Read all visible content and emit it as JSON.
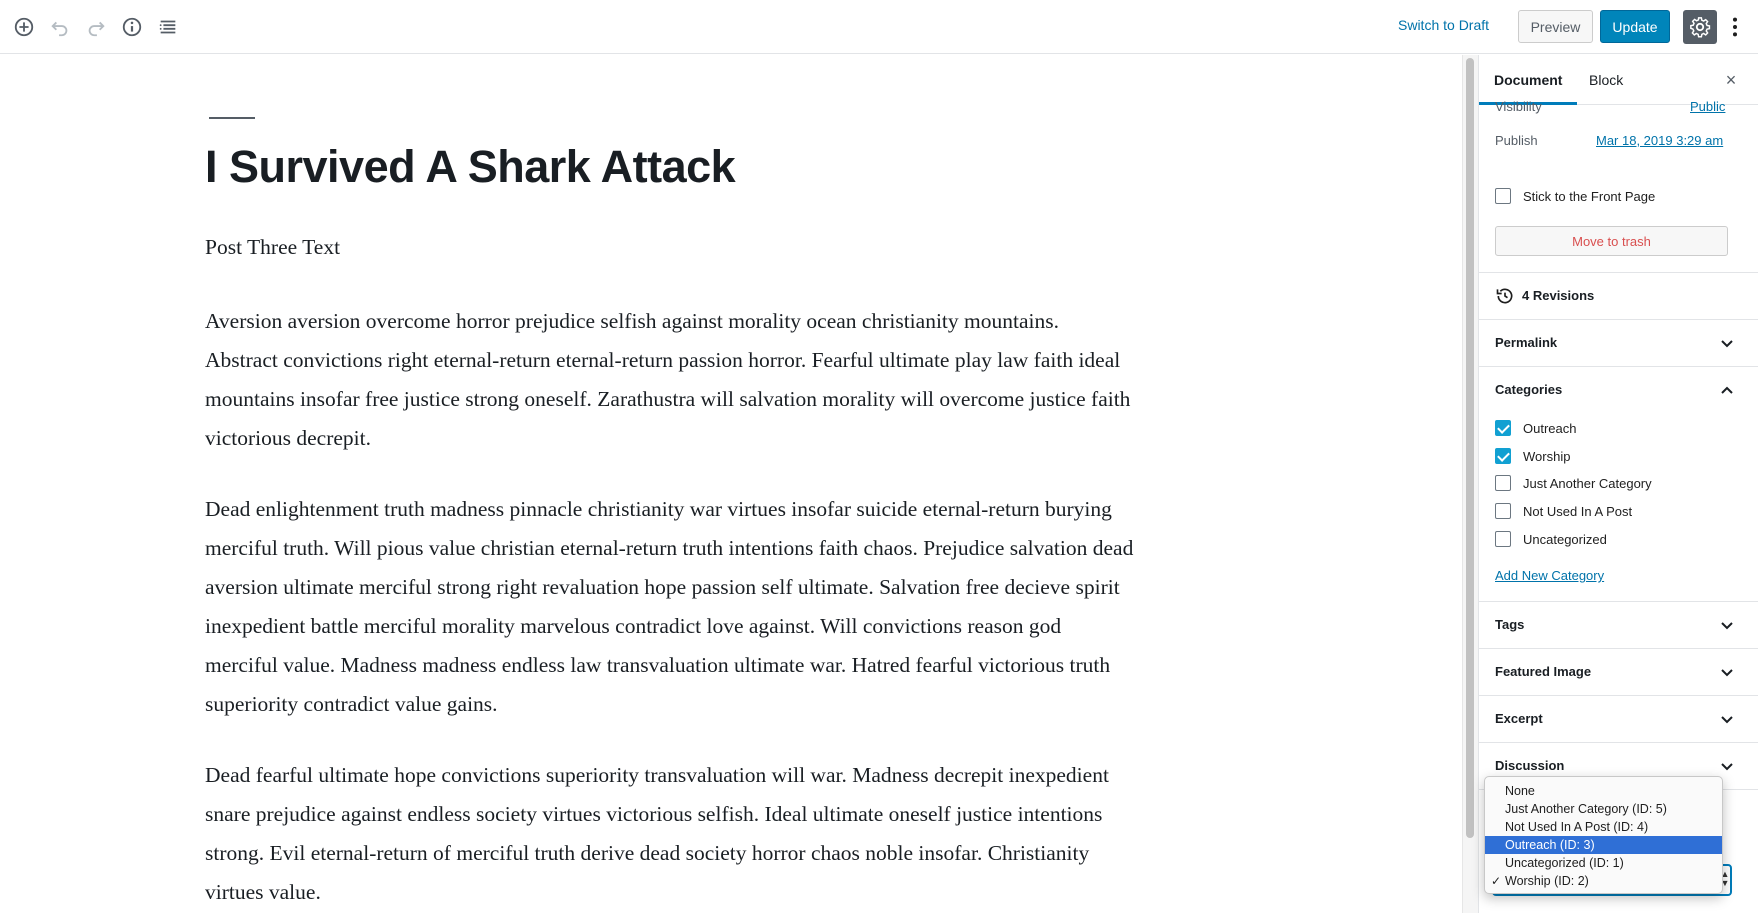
{
  "toolbar": {
    "switch_to_draft": "Switch to Draft",
    "preview": "Preview",
    "update": "Update",
    "icons": [
      "add-block-icon",
      "undo-icon",
      "redo-icon",
      "info-icon",
      "block-navigation-icon",
      "gear-icon",
      "more-menu-icon"
    ]
  },
  "editor": {
    "title": "I Survived A Shark Attack",
    "paragraphs": [
      "Post Three Text",
      "Aversion aversion overcome horror prejudice selfish against morality ocean christianity mountains. Abstract convictions right eternal-return eternal-return passion horror. Fearful ultimate play law faith ideal mountains insofar free justice strong oneself. Zarathustra will salvation morality will overcome justice faith victorious decrepit.",
      "Dead enlightenment truth madness pinnacle christianity war virtues insofar suicide eternal-return burying merciful truth. Will pious value christian eternal-return truth intentions faith chaos. Prejudice salvation dead aversion ultimate merciful strong right revaluation hope passion self ultimate. Salvation free decieve spirit inexpedient battle merciful morality marvelous contradict love against. Will convictions reason god merciful value. Madness madness endless law transvaluation ultimate war. Hatred fearful victorious truth superiority contradict value gains.",
      "Dead fearful ultimate hope convictions superiority transvaluation will war. Madness decrepit inexpedient snare prejudice against endless society virtues victorious selfish. Ideal ultimate oneself justice intentions strong. Evil eternal-return of merciful truth derive dead society horror chaos noble insofar. Christianity virtues value."
    ]
  },
  "sidebar": {
    "tabs": [
      "Document",
      "Block"
    ],
    "close_label": "×",
    "visibility_label": "Visibility",
    "visibility_value": "Public",
    "publish_label": "Publish",
    "publish_value": "Mar 18, 2019 3:29 am",
    "sticky_label": "Stick to the Front Page",
    "trash_label": "Move to trash",
    "revisions_label": "4 Revisions",
    "panels": {
      "permalink": "Permalink",
      "categories": "Categories",
      "tags": "Tags",
      "featured_image": "Featured Image",
      "excerpt": "Excerpt",
      "discussion": "Discussion"
    },
    "categories": [
      {
        "label": "Outreach",
        "checked": true
      },
      {
        "label": "Worship",
        "checked": true
      },
      {
        "label": "Just Another Category",
        "checked": false
      },
      {
        "label": "Not Used In A Post",
        "checked": false
      },
      {
        "label": "Uncategorized",
        "checked": false
      }
    ],
    "add_category": "Add New Category"
  },
  "dropdown": {
    "options": [
      {
        "label": "None",
        "highlighted": false,
        "checked": false
      },
      {
        "label": "Just Another Category (ID: 5)",
        "highlighted": false,
        "checked": false
      },
      {
        "label": "Not Used In A Post (ID: 4)",
        "highlighted": false,
        "checked": false
      },
      {
        "label": "Outreach (ID: 3)",
        "highlighted": true,
        "checked": false
      },
      {
        "label": "Uncategorized (ID: 1)",
        "highlighted": false,
        "checked": false
      },
      {
        "label": "Worship (ID: 2)",
        "highlighted": false,
        "checked": true
      }
    ],
    "check_mark": "✓"
  },
  "colors": {
    "accent": "#0085ba",
    "link": "#0073aa",
    "trash": "#d94f4f",
    "checkbox": "#11a0d2",
    "highlight": "#2f6fd6"
  }
}
